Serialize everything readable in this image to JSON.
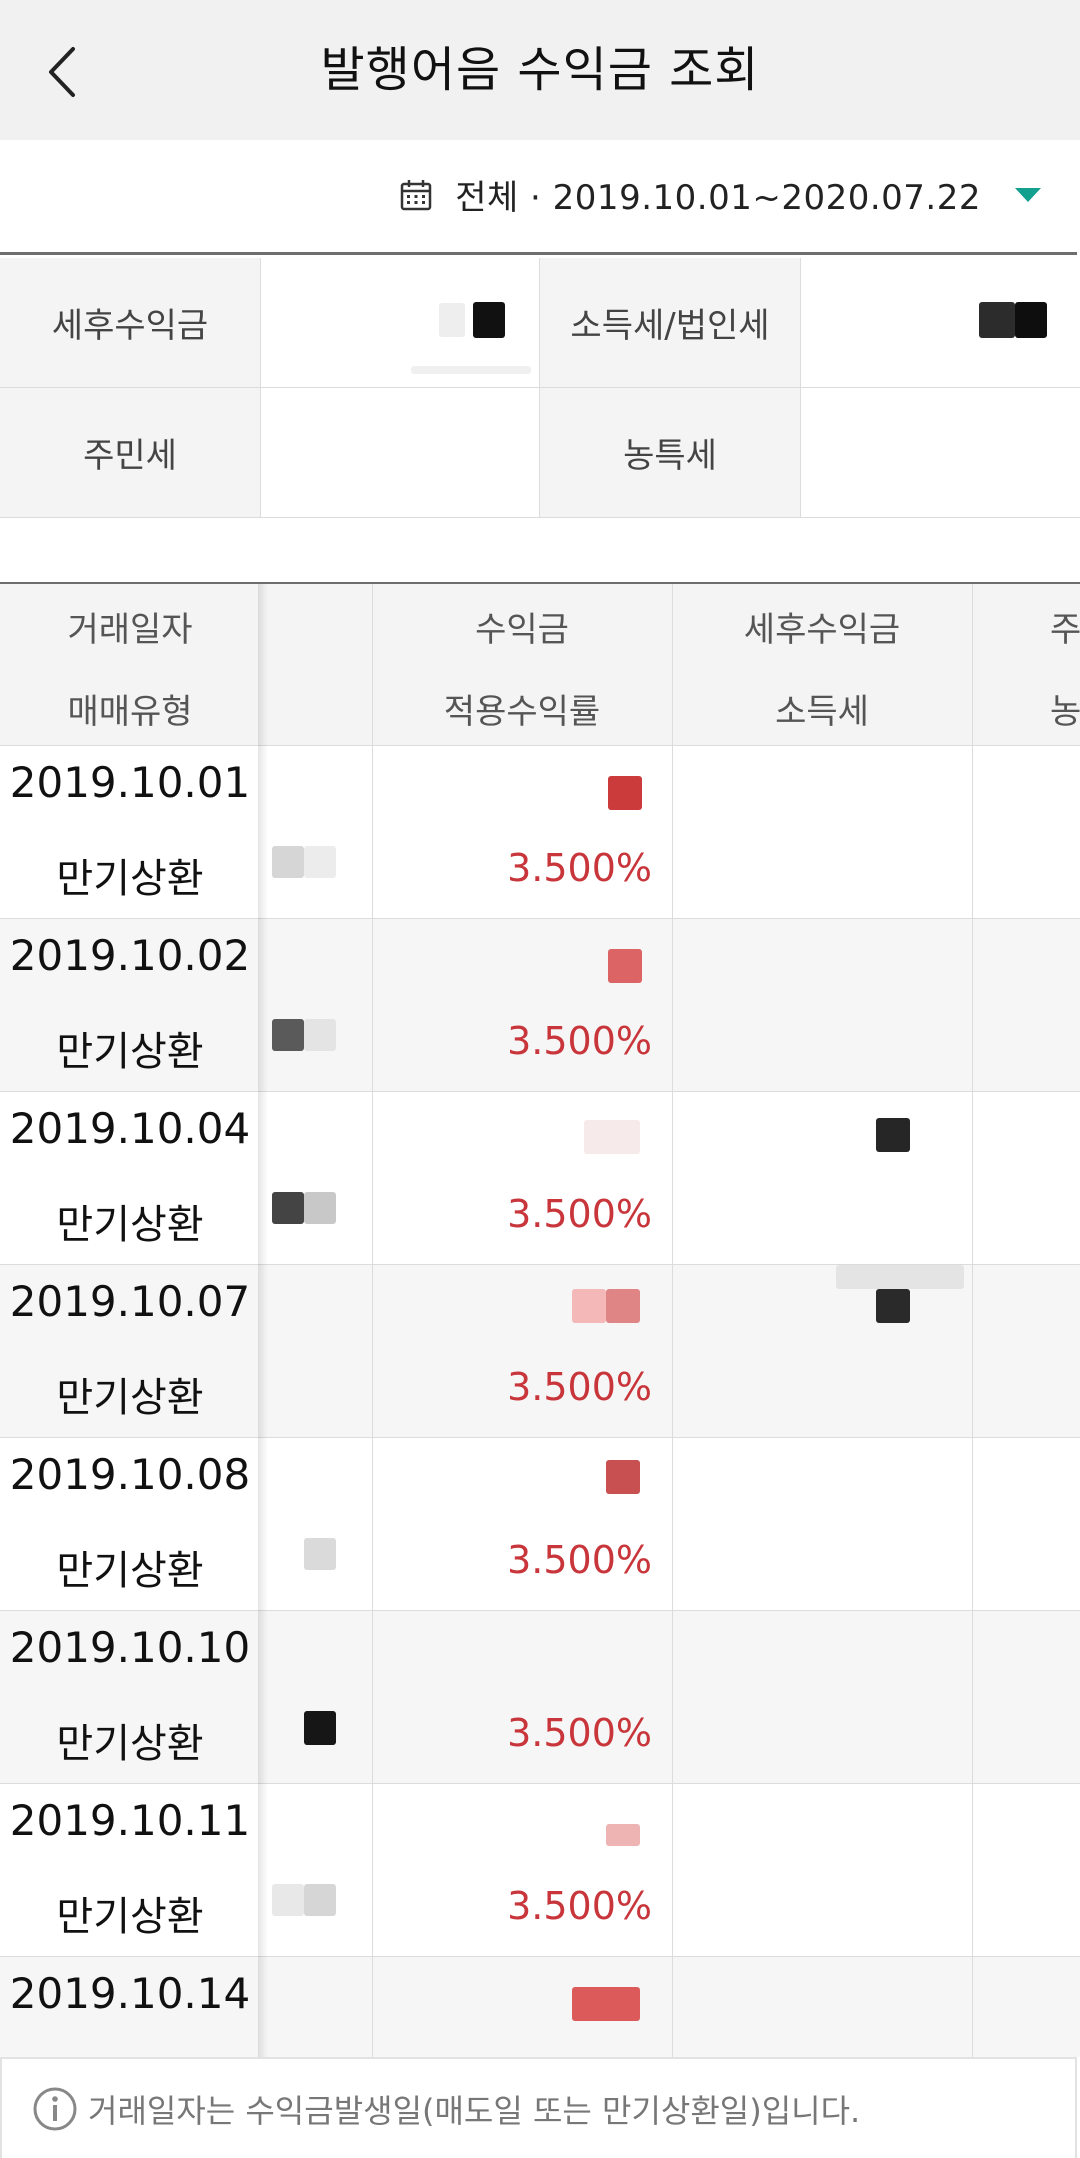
{
  "header": {
    "title": "발행어음 수익금 조회",
    "back_icon": "chevron-left-icon"
  },
  "period": {
    "text": "전체 · 2019.10.01~2020.07.22",
    "calendar_icon": "calendar-icon",
    "dropdown_icon": "caret-down-icon",
    "accent_color": "#14a08e"
  },
  "summary": {
    "after_tax_label": "세후수익금",
    "income_tax_label": "소득세/법인세",
    "resident_tax_label": "주민세",
    "rural_tax_label": "농특세"
  },
  "table": {
    "headers": {
      "col1_top": "거래일자",
      "col1_bottom": "매매유형",
      "col2_top": "수익금",
      "col2_bottom": "적용수익률",
      "col3_top": "세후수익금",
      "col3_bottom": "소득세",
      "col4_top": "주",
      "col4_bottom": "농"
    },
    "rows": [
      {
        "date": "2019.10.01",
        "type": "만기상환",
        "rate": "3.500%"
      },
      {
        "date": "2019.10.02",
        "type": "만기상환",
        "rate": "3.500%"
      },
      {
        "date": "2019.10.04",
        "type": "만기상환",
        "rate": "3.500%"
      },
      {
        "date": "2019.10.07",
        "type": "만기상환",
        "rate": "3.500%"
      },
      {
        "date": "2019.10.08",
        "type": "만기상환",
        "rate": "3.500%"
      },
      {
        "date": "2019.10.10",
        "type": "만기상환",
        "rate": "3.500%"
      },
      {
        "date": "2019.10.11",
        "type": "만기상환",
        "rate": "3.500%"
      },
      {
        "date": "2019.10.14",
        "type": "",
        "rate": ""
      }
    ],
    "rate_color": "#c8353a"
  },
  "footer": {
    "info_icon": "info-icon",
    "notice": "거래일자는 수익금발생일(매도일 또는 만기상환일)입니다."
  }
}
